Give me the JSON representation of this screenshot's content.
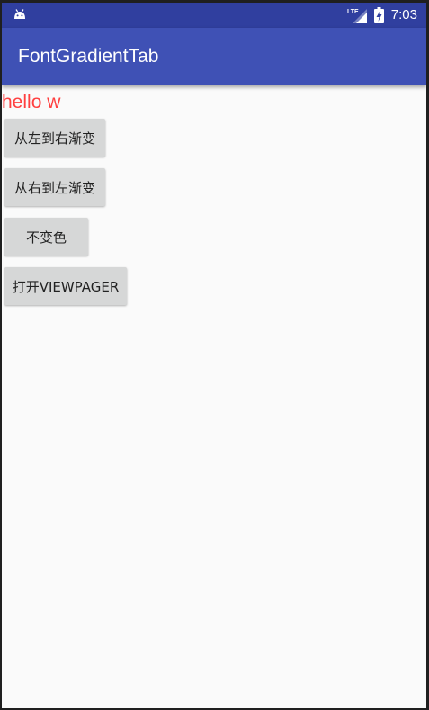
{
  "status_bar": {
    "time": "7:03",
    "network_label": "LTE",
    "icons": [
      "android-icon",
      "lte-signal-icon",
      "battery-charging-icon"
    ]
  },
  "toolbar": {
    "title": "FontGradientTab"
  },
  "main": {
    "gradient_text": "hello w",
    "buttons": [
      {
        "label": "从左到右渐变"
      },
      {
        "label": "从右到左渐变"
      },
      {
        "label": "不变色"
      },
      {
        "label": "打开VIEWPAGER"
      }
    ]
  },
  "colors": {
    "status_bar": "#303f9f",
    "toolbar": "#3f51b5",
    "background": "#fafafa",
    "gradient_text": "#ff4040",
    "button": "#d6d7d7"
  }
}
